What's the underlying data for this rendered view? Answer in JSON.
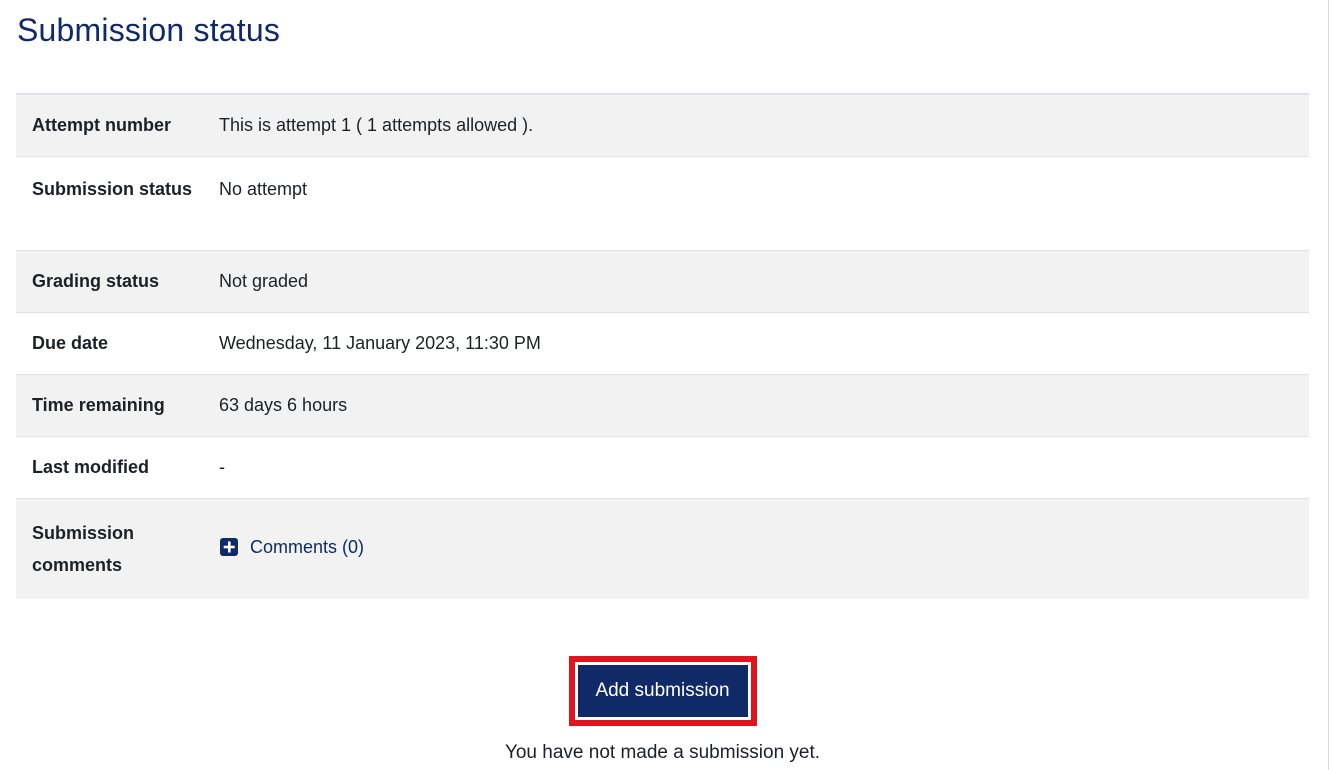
{
  "page": {
    "title": "Submission status"
  },
  "rows": [
    {
      "label": "Attempt number",
      "value": "This is attempt 1 ( 1 attempts allowed )."
    },
    {
      "label": "Submission status",
      "value": "No attempt"
    },
    {
      "label": "Grading status",
      "value": "Not graded"
    },
    {
      "label": "Due date",
      "value": "Wednesday, 11 January 2023, 11:30 PM"
    },
    {
      "label": "Time remaining",
      "value": "63 days 6 hours"
    },
    {
      "label": "Last modified",
      "value": "-"
    },
    {
      "label": "Submission comments",
      "value": "Comments (0)",
      "icon": "plus-square-icon"
    }
  ],
  "actions": {
    "add_submission_label": "Add submission",
    "note": "You have not made a submission yet."
  },
  "colors": {
    "brand": "#0f2a66",
    "highlight": "#e0141e",
    "row_shade": "#f2f2f2"
  }
}
